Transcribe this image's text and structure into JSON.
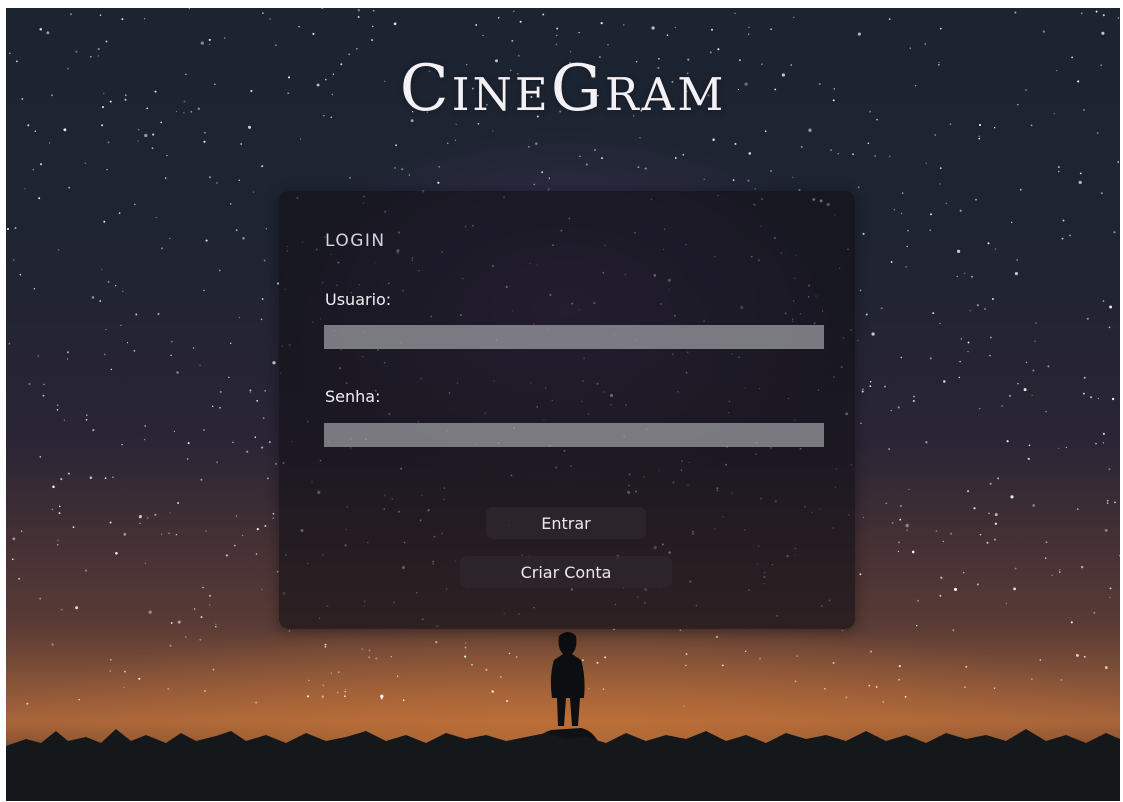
{
  "app": {
    "title": "CineGram"
  },
  "login": {
    "heading": "LOGIN",
    "username_label": "Usuario:",
    "username_value": "",
    "password_label": "Senha:",
    "password_value": "",
    "enter_button": "Entrar",
    "create_account_button": "Criar Conta"
  },
  "colors": {
    "card_background": "#121016",
    "input_background": "#a0a0a5",
    "button_background": "#2d262a",
    "text": "#f0eef3",
    "horizon_glow": "#cd7837"
  }
}
